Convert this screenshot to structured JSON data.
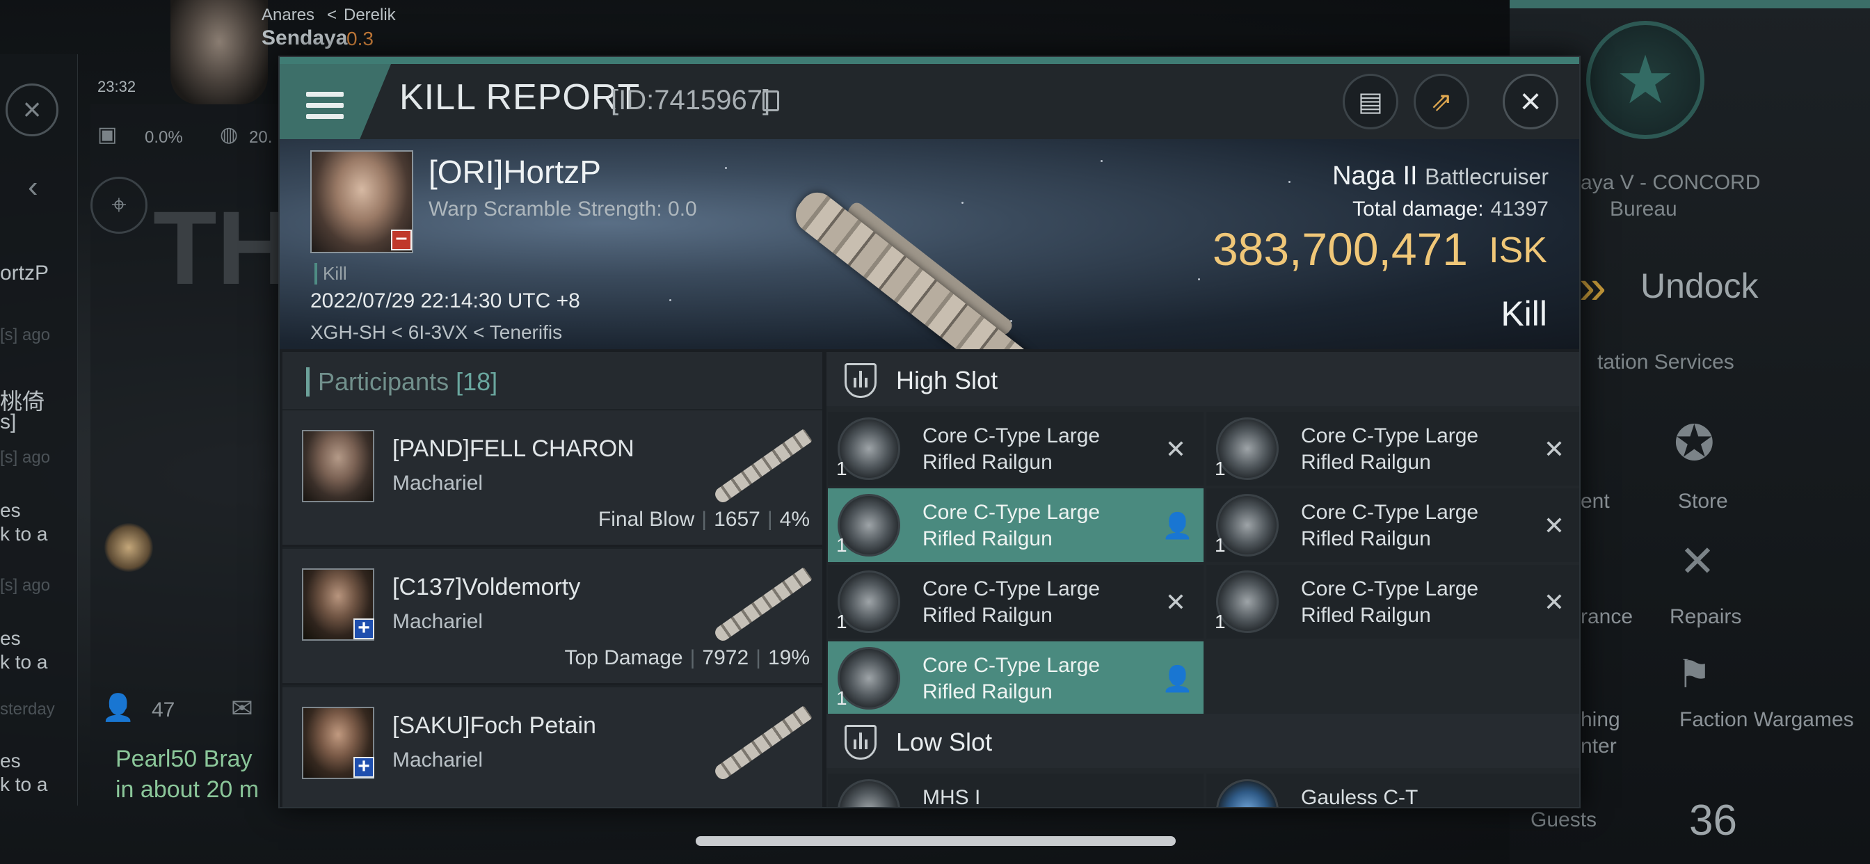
{
  "background": {
    "region": "Anares",
    "constellation": "Derelik",
    "system": "Sendaya",
    "security": "0.3",
    "clock": "23:32",
    "cargo_pct": "0.0%",
    "speed_partial": "20.",
    "left_strip": [
      "ortzP",
      "[s] ago",
      "桃倚",
      "s]",
      "[s] ago",
      "es",
      "k to a",
      "[s] ago",
      "es",
      "k to a",
      "sterday",
      "es",
      "k to a"
    ],
    "chat_count": "47",
    "chat_author": "Pearl50 Bray",
    "chat_preview": "in about 20 m",
    "station_name": "aya V - CONCORD",
    "station_sub": "Bureau",
    "undock_label": "Undock",
    "station_services": "tation Services",
    "services": [
      {
        "label": "Store",
        "icon": "nes-star-icon"
      },
      {
        "label": "Repairs",
        "icon": "wrench-icon"
      },
      {
        "label": "Faction Wargames",
        "icon": "crossed-flags-icon"
      }
    ],
    "partial_services": [
      "ent",
      "rance",
      "hing",
      "nter"
    ],
    "guests_label": "Guests",
    "guests_count": "36",
    "scoreboard_partial": "THE SC"
  },
  "modal": {
    "title": "KILL REPORT",
    "id_text": "[ID:7415967]",
    "victim": {
      "name": "[ORI]HortzP",
      "warp_scramble": "Warp Scramble Strength: 0.0",
      "tag": "Kill",
      "date": "2022/07/29 22:14:30 UTC +8",
      "location": "XGH-SH < 6I-3VX < Tenerifis"
    },
    "ship": {
      "name": "Naga II",
      "class": "Battlecruiser",
      "total_damage_label": "Total damage:",
      "total_damage": "41397",
      "isk_value": "383,700,471",
      "isk_unit": "ISK",
      "result": "Kill"
    },
    "participants": {
      "label": "Participants",
      "count": "[18]",
      "rows": [
        {
          "name": "[PAND]FELL CHARON",
          "ship": "Machariel",
          "role": "Final Blow",
          "damage": "1657",
          "pct": "4%"
        },
        {
          "name": "[C137]Voldemorty",
          "ship": "Machariel",
          "role": "Top Damage",
          "damage": "7972",
          "pct": "19%"
        },
        {
          "name": "[SAKU]Foch Petain",
          "ship": "Machariel",
          "role": "",
          "damage": "",
          "pct": ""
        }
      ]
    },
    "high_slot": {
      "label": "High Slot",
      "modules": [
        {
          "name": "Core C-Type Large Rifled Railgun",
          "qty": "1",
          "status": "destroyed"
        },
        {
          "name": "Core C-Type Large Rifled Railgun",
          "qty": "1",
          "status": "destroyed"
        },
        {
          "name": "Core C-Type Large Rifled Railgun",
          "qty": "1",
          "status": "dropped"
        },
        {
          "name": "Core C-Type Large Rifled Railgun",
          "qty": "1",
          "status": "destroyed"
        },
        {
          "name": "Core C-Type Large Rifled Railgun",
          "qty": "1",
          "status": "destroyed"
        },
        {
          "name": "Core C-Type Large Rifled Railgun",
          "qty": "1",
          "status": "destroyed"
        },
        {
          "name": "Core C-Type Large Rifled Railgun",
          "qty": "1",
          "status": "dropped"
        }
      ]
    },
    "low_slot": {
      "label": "Low Slot",
      "partial_modules": [
        "MHS I",
        "Gauless C-T"
      ]
    }
  },
  "colors": {
    "accent_teal": "#3f7c74",
    "dropped_bg": "#4a8a7f",
    "isk_gold": "#f0c778",
    "badge_red": "#c0392b",
    "badge_blue": "#1f4fae"
  }
}
